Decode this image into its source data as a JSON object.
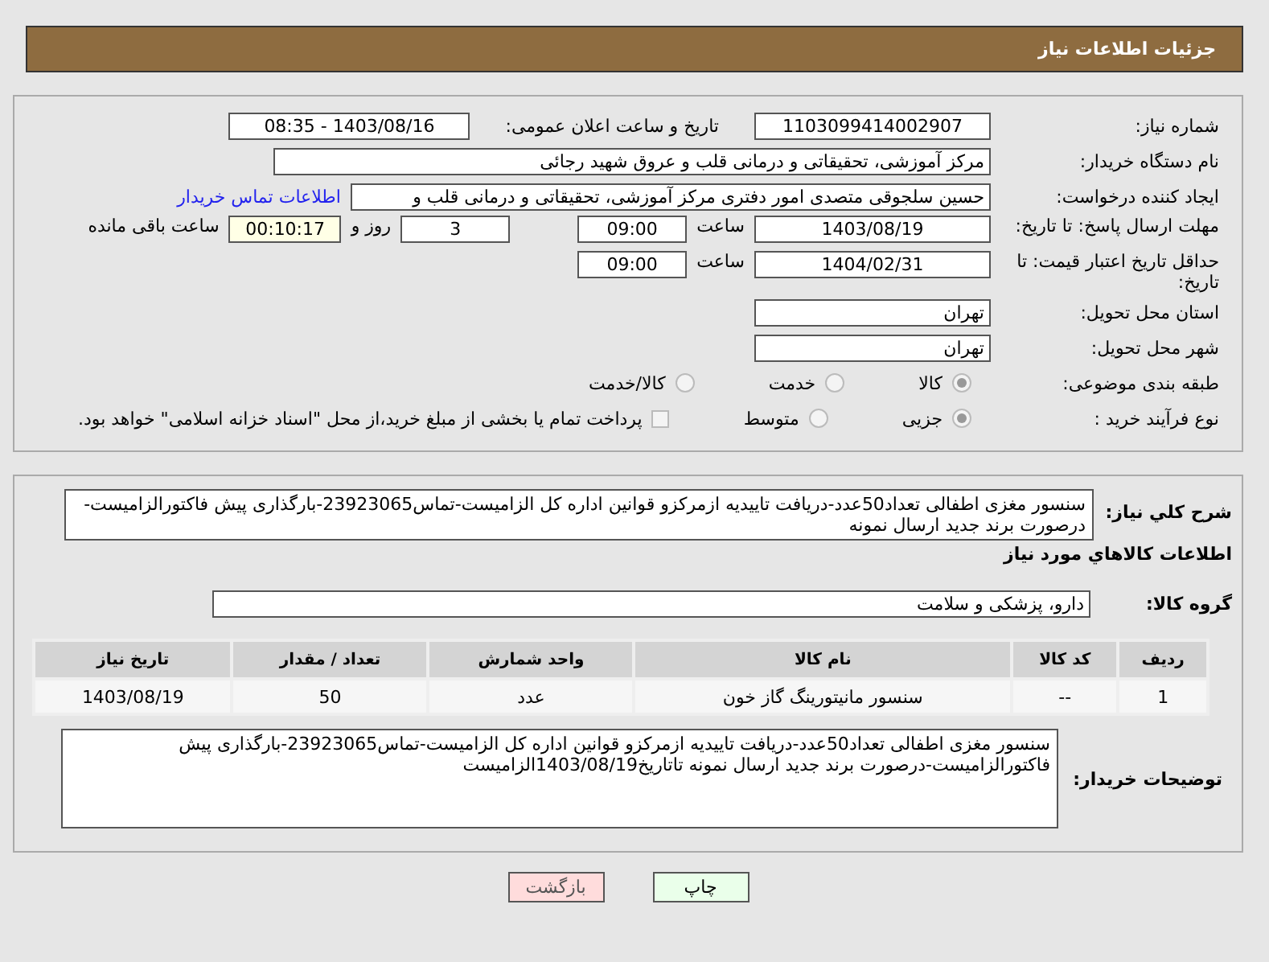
{
  "header": {
    "title": "جزئیات اطلاعات نیاز"
  },
  "need_number": {
    "label": "شماره نیاز:",
    "value": "1103099414002907"
  },
  "announce": {
    "label": "تاریخ و ساعت اعلان عمومی:",
    "value": "1403/08/16 - 08:35"
  },
  "buyer": {
    "label": "نام دستگاه خریدار:",
    "value": "مرکز آموزشی، تحقیقاتی و درمانی قلب و عروق شهید رجائی"
  },
  "creator": {
    "label": "ایجاد کننده درخواست:",
    "value": "حسین سلجوقی متصدی امور دفتری مرکز آموزشی، تحقیقاتی و درمانی قلب و",
    "link": "اطلاعات تماس خریدار"
  },
  "deadline": {
    "label": "مهلت ارسال پاسخ: تا تاریخ:",
    "date": "1403/08/19",
    "time_label": "ساعت",
    "time": "09:00",
    "days": "3",
    "days_label": "روز و",
    "remaining": "00:10:17",
    "remaining_label": "ساعت باقی مانده"
  },
  "validity": {
    "label": "حداقل تاریخ اعتبار قیمت: تا تاریخ:",
    "date": "1404/02/31",
    "time_label": "ساعت",
    "time": "09:00"
  },
  "province": {
    "label": "استان محل تحویل:",
    "value": "تهران"
  },
  "city": {
    "label": "شهر محل تحویل:",
    "value": "تهران"
  },
  "category": {
    "label": "طبقه بندی موضوعی:",
    "options": [
      {
        "label": "کالا",
        "selected": true
      },
      {
        "label": "خدمت",
        "selected": false
      },
      {
        "label": "کالا/خدمت",
        "selected": false
      }
    ]
  },
  "process": {
    "label": "نوع فرآیند خرید :",
    "options": [
      {
        "label": "جزیی",
        "selected": true
      },
      {
        "label": "متوسط",
        "selected": false
      }
    ],
    "checkbox": {
      "label": "پرداخت تمام یا بخشی از مبلغ خرید،از محل \"اسناد خزانه اسلامی\" خواهد بود.",
      "checked": false
    }
  },
  "summary": {
    "label": "شرح کلي نياز:",
    "value": "سنسور مغزی اطفالی تعداد50عدد-دریافت تاییدیه ازمرکزو قوانین اداره کل الزامیست-تماس23923065-بارگذاری پیش فاکتورالزامیست-درصورت برند جدید ارسال نمونه"
  },
  "goods_title": "اطلاعات کالاهاي مورد نياز",
  "goods_group": {
    "label": "گروه کالا:",
    "value": "دارو، پزشکی و سلامت"
  },
  "table": {
    "columns": [
      "ردیف",
      "کد کالا",
      "نام کالا",
      "واحد شمارش",
      "تعداد / مقدار",
      "تاریخ نیاز"
    ],
    "rows": [
      [
        "1",
        "--",
        "سنسور مانیتورینگ گاز خون",
        "عدد",
        "50",
        "1403/08/19"
      ]
    ]
  },
  "buyer_notes": {
    "label": "توضیحات خریدار:",
    "value": "سنسور مغزی اطفالی تعداد50عدد-دریافت تاییدیه ازمرکزو قوانین اداره کل الزامیست-تماس23923065-بارگذاری پیش فاکتورالزامیست-درصورت برند جدید ارسال نمونه تاتاریخ1403/08/19الزامیست"
  },
  "buttons": [
    {
      "label": "چاپ",
      "kind": "print"
    },
    {
      "label": "بازگشت",
      "kind": "back"
    }
  ]
}
